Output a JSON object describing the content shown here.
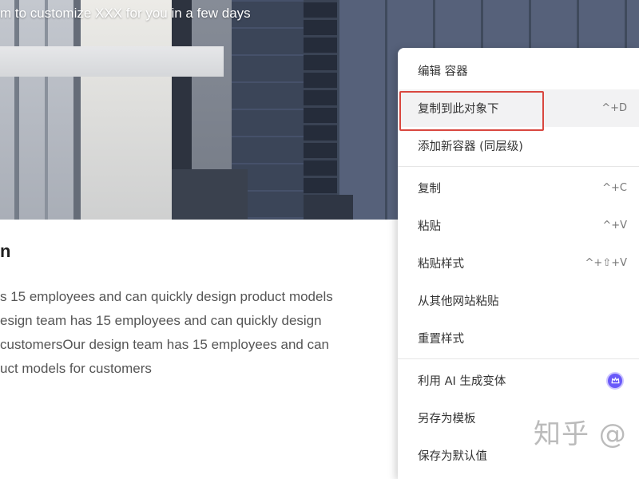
{
  "hero": {
    "caption": "m to customize XXX for you in a few days"
  },
  "content": {
    "heading": "n",
    "paragraph_lines": [
      "s 15 employees and can quickly design product models",
      "esign team has 15 employees and can quickly design",
      "customersOur design team has 15 employees and can",
      "uct models for customers"
    ]
  },
  "context_menu": {
    "items": [
      {
        "label": "编辑 容器"
      },
      {
        "label": "复制到此对象下",
        "shortcut": "^+D",
        "hovered": true,
        "annotated": true
      },
      {
        "label": "添加新容器 (同层级)"
      },
      {
        "label": "复制",
        "shortcut": "^+C"
      },
      {
        "label": "粘贴",
        "shortcut": "^+V"
      },
      {
        "label": "粘贴样式",
        "shortcut": "^+⇧+V"
      },
      {
        "label": "从其他网站粘贴"
      },
      {
        "label": "重置样式"
      },
      {
        "label": "利用 AI 生成变体",
        "badge_icon": "crown-icon"
      },
      {
        "label": "另存为模板"
      },
      {
        "label": "保存为默认值"
      }
    ]
  },
  "watermark": {
    "text": "知乎 @"
  },
  "colors": {
    "menu_hover": "#f2f2f3",
    "annotation_red": "#d9473f",
    "ai_badge": "#6a5af9",
    "text_primary": "#333333",
    "text_shortcut": "#777777"
  }
}
